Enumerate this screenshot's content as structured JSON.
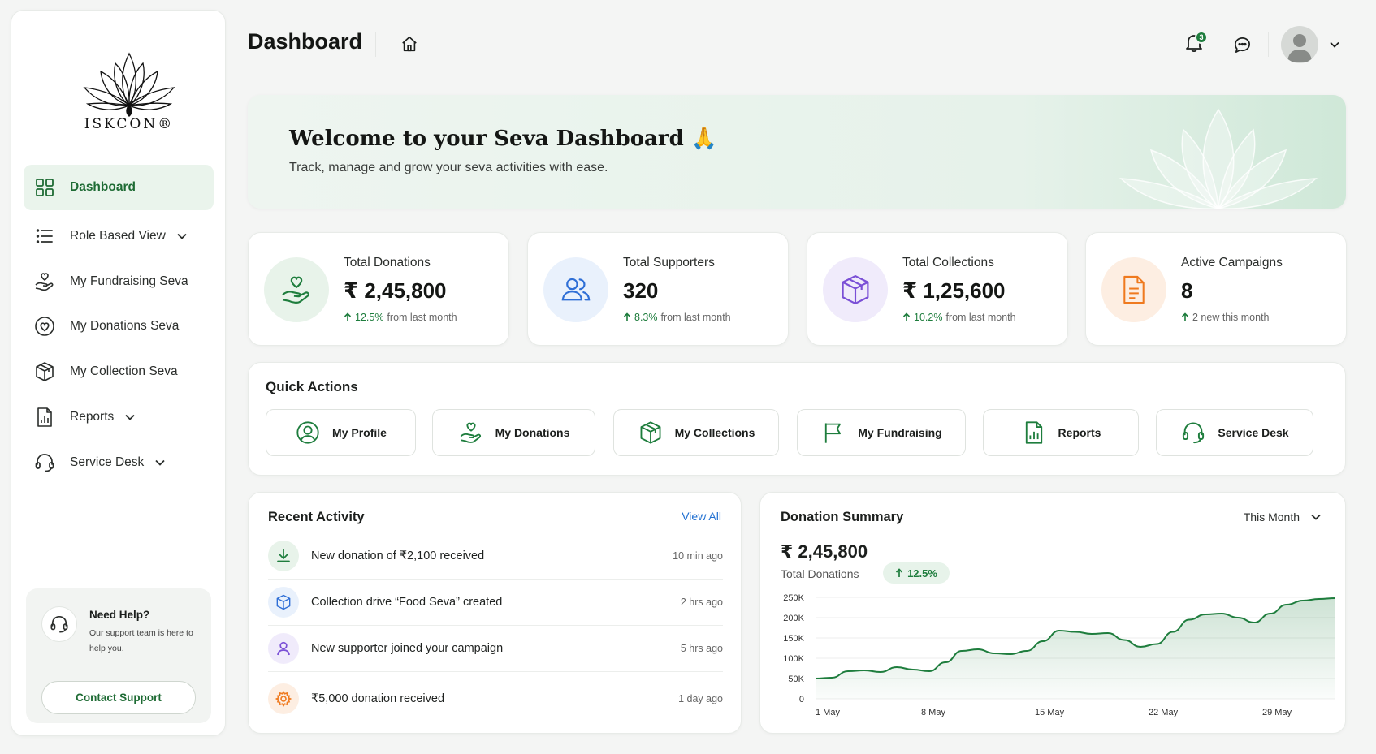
{
  "app": {
    "logo_text": "ISKCON®"
  },
  "sidebar": {
    "items": [
      {
        "label": "Dashboard",
        "icon": "grid-icon",
        "active": true
      },
      {
        "label": "Role Based View",
        "icon": "list-icon",
        "dropdown": true
      },
      {
        "label": "My Fundraising Seva",
        "icon": "hand-heart-icon"
      },
      {
        "label": "My Donations Seva",
        "icon": "heart-circle-icon"
      },
      {
        "label": "My Collection Seva",
        "icon": "box-icon"
      },
      {
        "label": "Reports",
        "icon": "report-icon",
        "dropdown": true
      },
      {
        "label": "Service Desk",
        "icon": "headset-icon",
        "dropdown": true
      }
    ],
    "help": {
      "title": "Need Help?",
      "text": "Our support team is here to help you.",
      "button": "Contact Support"
    }
  },
  "header": {
    "title": "Dashboard",
    "notification_count": "3"
  },
  "banner": {
    "title": "Welcome to your Seva Dashboard 🙏",
    "subtitle": "Track, manage and grow your seva activities with ease."
  },
  "stats": [
    {
      "label": "Total Donations",
      "value": "₹ 2,45,800",
      "delta_pct": "12.5%",
      "delta_text": "from last month",
      "color": "#1e7d3d",
      "bg": "#e8f3ea",
      "icon": "hand-heart-icon"
    },
    {
      "label": "Total Supporters",
      "value": "320",
      "delta_pct": "8.3%",
      "delta_text": "from last month",
      "color": "#2f6fd6",
      "bg": "#e9f1fc",
      "icon": "users-icon"
    },
    {
      "label": "Total Collections",
      "value": "₹ 1,25,600",
      "delta_pct": "10.2%",
      "delta_text": "from last month",
      "color": "#7a4fd6",
      "bg": "#f0ebfb",
      "icon": "box-icon"
    },
    {
      "label": "Active Campaigns",
      "value": "8",
      "delta_pct": "",
      "delta_text": "2 new this month",
      "color": "#ef7a1f",
      "bg": "#fdeee2",
      "icon": "document-icon"
    }
  ],
  "quick_actions": {
    "title": "Quick Actions",
    "items": [
      {
        "label": "My Profile",
        "icon": "user-circle-icon"
      },
      {
        "label": "My Donations",
        "icon": "hand-heart-icon"
      },
      {
        "label": "My Collections",
        "icon": "box-icon"
      },
      {
        "label": "My Fundraising",
        "icon": "flag-icon"
      },
      {
        "label": "Reports",
        "icon": "report-icon"
      },
      {
        "label": "Service Desk",
        "icon": "headset-icon"
      }
    ]
  },
  "recent_activity": {
    "title": "Recent Activity",
    "view_all": "View All",
    "items": [
      {
        "text": "New donation of ₹2,100 received",
        "time": "10 min ago",
        "icon": "download-icon",
        "color": "#1e7d3d",
        "bg": "#e8f3ea"
      },
      {
        "text": "Collection drive “Food Seva” created",
        "time": "2 hrs ago",
        "icon": "box-icon",
        "color": "#2f6fd6",
        "bg": "#e9f1fc"
      },
      {
        "text": "New supporter joined your campaign",
        "time": "5 hrs ago",
        "icon": "user-icon",
        "color": "#7a4fd6",
        "bg": "#f0ebfb"
      },
      {
        "text": "₹5,000 donation received",
        "time": "1 day ago",
        "icon": "gear-icon",
        "color": "#ef7a1f",
        "bg": "#fdeee2"
      }
    ]
  },
  "donation_summary": {
    "title": "Donation Summary",
    "filter": "This Month",
    "value": "₹ 2,45,800",
    "label": "Total Donations",
    "badge": "12.5%"
  },
  "chart_data": {
    "type": "area",
    "title": "",
    "xlabel": "",
    "ylabel": "",
    "ylim": [
      0,
      250000
    ],
    "y_ticks": [
      0,
      50000,
      100000,
      150000,
      200000,
      250000
    ],
    "y_tick_labels": [
      "0",
      "50K",
      "100K",
      "150K",
      "200K",
      "250K"
    ],
    "x_ticks": [
      1,
      8,
      15,
      22,
      29
    ],
    "x_tick_labels": [
      "1 May",
      "8 May",
      "15 May",
      "22 May",
      "29 May"
    ],
    "xlim": [
      1,
      33
    ],
    "grid": true,
    "color": "#1e7d3d",
    "series": [
      {
        "x": [
          1,
          2,
          3,
          4,
          5,
          6,
          7,
          8,
          9,
          10,
          11,
          12,
          13,
          14,
          15,
          16,
          17,
          18,
          19,
          20,
          21,
          22,
          23,
          24,
          25,
          26,
          27,
          28,
          29,
          30,
          31,
          32,
          33
        ],
        "values": [
          50000,
          52000,
          68000,
          70000,
          66000,
          78000,
          72000,
          68000,
          90000,
          118000,
          122000,
          112000,
          110000,
          118000,
          142000,
          168000,
          165000,
          160000,
          162000,
          145000,
          128000,
          135000,
          165000,
          195000,
          208000,
          210000,
          200000,
          188000,
          210000,
          232000,
          242000,
          246000,
          248000
        ]
      }
    ]
  }
}
